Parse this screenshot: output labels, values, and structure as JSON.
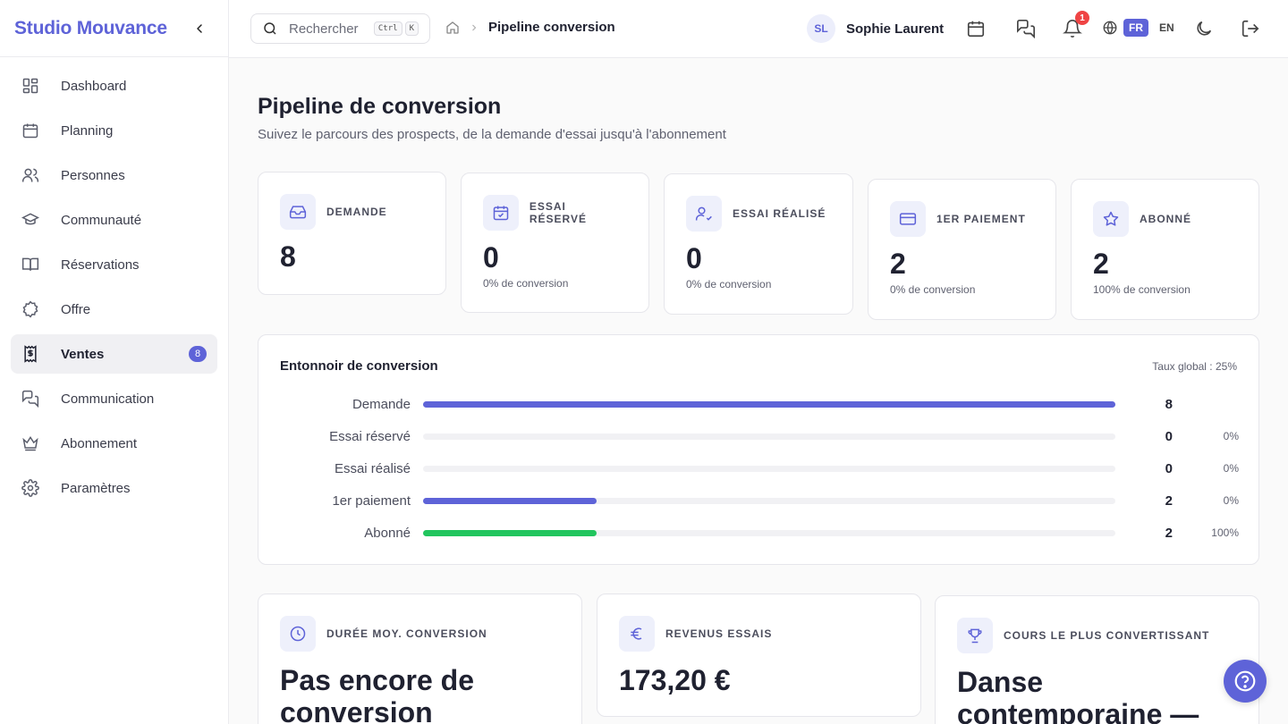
{
  "brand": {
    "name": "Studio Mouvance"
  },
  "nav": {
    "items": [
      {
        "label": "Dashboard"
      },
      {
        "label": "Planning"
      },
      {
        "label": "Personnes"
      },
      {
        "label": "Communauté"
      },
      {
        "label": "Réservations"
      },
      {
        "label": "Offre"
      },
      {
        "label": "Ventes",
        "badge": "8",
        "active": true
      },
      {
        "label": "Communication"
      },
      {
        "label": "Abonnement"
      },
      {
        "label": "Paramètres"
      }
    ]
  },
  "topbar": {
    "search_placeholder": "Rechercher",
    "shortcut": [
      "Ctrl",
      "K"
    ],
    "breadcrumb_current": "Pipeline conversion",
    "user_initials": "SL",
    "user_name": "Sophie Laurent",
    "notifications_count": "1",
    "lang_active": "FR",
    "lang_other": "EN"
  },
  "page": {
    "title": "Pipeline de conversion",
    "subtitle": "Suivez le parcours des prospects, de la demande d'essai jusqu'à l'abonnement"
  },
  "kpis": [
    {
      "label": "Demande",
      "value": "8",
      "sub": ""
    },
    {
      "label": "Essai réservé",
      "value": "0",
      "sub": "0% de conversion"
    },
    {
      "label": "Essai réalisé",
      "value": "0",
      "sub": "0% de conversion"
    },
    {
      "label": "1er paiement",
      "value": "2",
      "sub": "0% de conversion"
    },
    {
      "label": "Abonné",
      "value": "2",
      "sub": "100% de conversion"
    }
  ],
  "funnel": {
    "title": "Entonnoir de conversion",
    "global_rate": "Taux global : 25%",
    "rows": [
      {
        "label": "Demande",
        "count": "8",
        "pct": "",
        "fill": 1.0
      },
      {
        "label": "Essai réservé",
        "count": "0",
        "pct": "0%",
        "fill": 0
      },
      {
        "label": "Essai réalisé",
        "count": "0",
        "pct": "0%",
        "fill": 0
      },
      {
        "label": "1er paiement",
        "count": "2",
        "pct": "0%",
        "fill": 0.25
      },
      {
        "label": "Abonné",
        "count": "2",
        "pct": "100%",
        "fill": 0.25
      }
    ]
  },
  "stats": [
    {
      "label": "Durée moy. conversion",
      "value": "Pas encore de conversion"
    },
    {
      "label": "Revenus essais",
      "value": "173,20 €"
    },
    {
      "label": "Cours le plus convertissant",
      "value": "Danse contemporaine —"
    }
  ],
  "colors": {
    "accent": "#5e63d8",
    "success": "#22c55e",
    "danger": "#ef4444"
  }
}
